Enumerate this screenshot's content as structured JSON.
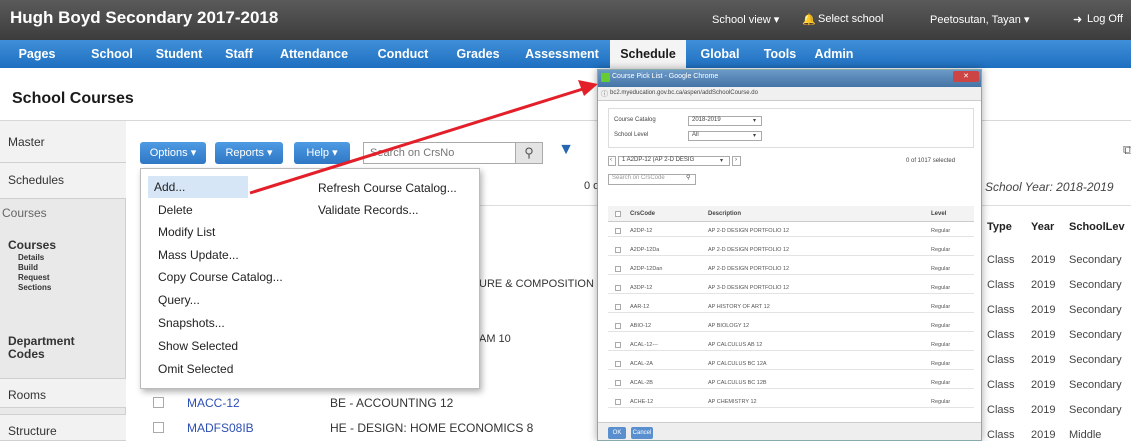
{
  "app": {
    "school_title": "Hugh Boyd Secondary 2017-2018",
    "school_view": "School view ▾",
    "select_school": "Select school",
    "user": "Peetosutan, Tayan ▾",
    "logoff": "Log Off"
  },
  "nav": {
    "tabs": [
      "Pages",
      "School",
      "Student",
      "Staff",
      "Attendance",
      "Conduct",
      "Grades",
      "Assessment",
      "Schedule",
      "Global",
      "Tools",
      "Admin"
    ],
    "active": "Schedule"
  },
  "page": {
    "title": "School Courses"
  },
  "sidebar": {
    "master": "Master",
    "schedules": "Schedules",
    "courses_tab": "Courses",
    "courses_group": "Courses",
    "courses_sub": [
      "Details",
      "Build",
      "Request",
      "Sections"
    ],
    "department": "Department Codes",
    "rooms": "Rooms",
    "structure": "Structure"
  },
  "toolbar": {
    "options": "Options ▾",
    "reports": "Reports ▾",
    "help": "Help ▾",
    "search_placeholder": "Search on CrsNo",
    "count_partial": "0 o"
  },
  "menu": {
    "left": [
      "Add...",
      "Delete",
      "Modify List",
      "Mass Update...",
      "Copy Course Catalog...",
      "Query...",
      "Snapshots...",
      "Show Selected",
      "Omit Selected"
    ],
    "right": [
      "Refresh Course Catalog...",
      "Validate Records..."
    ]
  },
  "table": {
    "partial_1": "URE & COMPOSITION",
    "partial_2": "AM 10",
    "rows": [
      {
        "code": "MACC-12",
        "desc": "BE - ACCOUNTING 12"
      },
      {
        "code": "MADFS08IB",
        "desc": "HE - DESIGN: HOME ECONOMICS 8"
      }
    ]
  },
  "popup": {
    "title": "Course Pick List - Google Chrome",
    "url": "bc2.myeducation.gov.bc.ca/aspen/addSchoolCourse.do",
    "catalog_label": "Course Catalog",
    "catalog_value": "2018-2019",
    "level_label": "School Level",
    "level_value": "All",
    "filter_value": "1 A2DP-12 (AP 2-D DESIG",
    "selected_count": "0 of 1017 selected",
    "search_placeholder": "Search on CrsCode",
    "headers": [
      "CrsCode",
      "Description",
      "Level"
    ],
    "rows": [
      {
        "code": "A2DP-12",
        "desc": "AP 2-D DESIGN PORTFOLIO 12",
        "level": "Regular"
      },
      {
        "code": "A2DP-12Da",
        "desc": "AP 2-D DESIGN PORTFOLIO 12",
        "level": "Regular"
      },
      {
        "code": "A2DP-12Dan",
        "desc": "AP 2-D DESIGN PORTFOLIO 12",
        "level": "Regular"
      },
      {
        "code": "A3DP-12",
        "desc": "AP 3-D DESIGN PORTFOLIO 12",
        "level": "Regular"
      },
      {
        "code": "AAR-12",
        "desc": "AP HISTORY OF ART 12",
        "level": "Regular"
      },
      {
        "code": "ABIO-12",
        "desc": "AP BIOLOGY 12",
        "level": "Regular"
      },
      {
        "code": "ACAL-12---",
        "desc": "AP CALCULUS AB 12",
        "level": "Regular"
      },
      {
        "code": "ACAL-2A",
        "desc": "AP CALCULUS BC 12A",
        "level": "Regular"
      },
      {
        "code": "ACAL-2B",
        "desc": "AP CALCULUS BC 12B",
        "level": "Regular"
      },
      {
        "code": "ACHE-12",
        "desc": "AP CHEMISTRY 12",
        "level": "Regular"
      }
    ],
    "ok": "OK",
    "cancel": "Cancel"
  },
  "right": {
    "school_year": "School Year: 2018-2019",
    "headers": [
      "Type",
      "Year",
      "SchoolLev"
    ],
    "rows": [
      [
        "Class",
        "2019",
        "Secondary"
      ],
      [
        "Class",
        "2019",
        "Secondary"
      ],
      [
        "Class",
        "2019",
        "Secondary"
      ],
      [
        "Class",
        "2019",
        "Secondary"
      ],
      [
        "Class",
        "2019",
        "Secondary"
      ],
      [
        "Class",
        "2019",
        "Secondary"
      ],
      [
        "Class",
        "2019",
        "Secondary"
      ],
      [
        "Class",
        "2019",
        "Middle"
      ]
    ]
  },
  "colors": {
    "nav_blue": "#2a7bcf",
    "annotation_arrow": "#e3202a",
    "link": "#2d4fb3"
  }
}
